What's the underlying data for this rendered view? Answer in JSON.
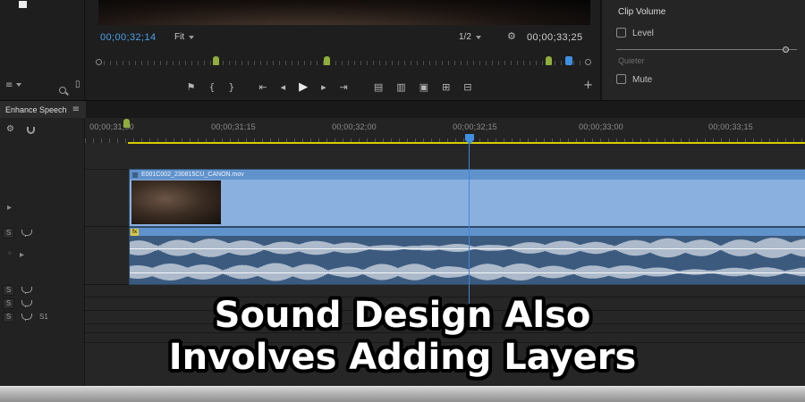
{
  "program_monitor": {
    "current_timecode": "00;00;32;14",
    "zoom_select": "Fit",
    "playback_resolution": "1/2",
    "sequence_out_timecode": "00;00;33;25"
  },
  "clip_volume_panel": {
    "title": "Clip Volume",
    "level_label": "Level",
    "quieter_label": "Quieter",
    "mute_label": "Mute"
  },
  "enhance_speech_tab": {
    "label": "Enhance Speech"
  },
  "timeline": {
    "ruler_ticks": [
      "00;00;31;00",
      "00;00;31;15",
      "00;00;32;00",
      "00;00;32;15",
      "00;00;33;00",
      "00;00;33;15"
    ],
    "video_clip_name": "E001C002_230815CU_CANON.mov",
    "audio_fx_badge": "fx",
    "solo_button_label": "S",
    "source_track_label": "S1"
  },
  "caption_overlay": {
    "line1": "Sound Design Also",
    "line2": "Involves Adding Layers"
  },
  "icons": {
    "list": "≡",
    "menu": "≡",
    "page": "▯",
    "wrench": "⚙",
    "marker": "⚑",
    "brace_open": "{",
    "brace_close": "}",
    "go_to_in": "⇤",
    "step_back": "◂",
    "play": "▶",
    "step_forward": "▸",
    "go_to_out": "⇥",
    "lift": "▤",
    "extract": "▥",
    "export_frame": "▣",
    "compare_view": "⊞",
    "multi_view": "⊟",
    "add": "+",
    "expand": "▸",
    "dot": "◦"
  },
  "colors": {
    "timecode_blue": "#4aa0e8",
    "clip_blue": "#8ab0e0",
    "waveform_bg": "#3b5a7e",
    "ruler_yellow": "#d7ce00",
    "marker_green": "#8fae3c",
    "playhead_blue": "#3f8fe0"
  }
}
